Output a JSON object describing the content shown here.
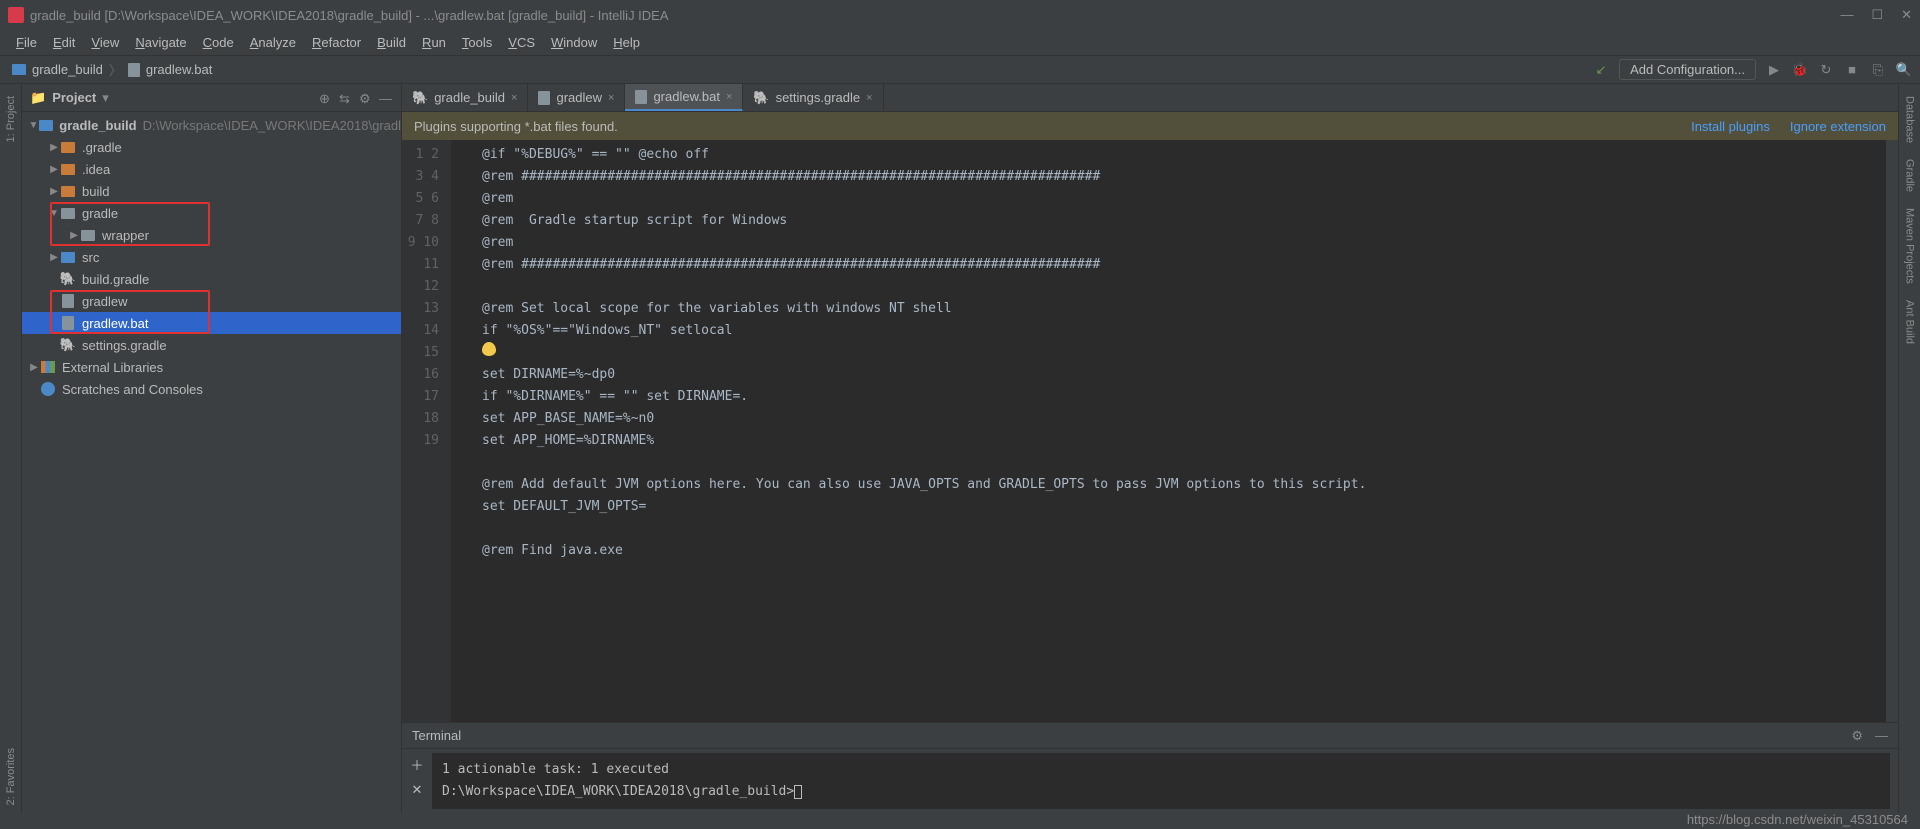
{
  "title": "gradle_build [D:\\Workspace\\IDEA_WORK\\IDEA2018\\gradle_build] - ...\\gradlew.bat [gradle_build] - IntelliJ IDEA",
  "menus": [
    "File",
    "Edit",
    "View",
    "Navigate",
    "Code",
    "Analyze",
    "Refactor",
    "Build",
    "Run",
    "Tools",
    "VCS",
    "Window",
    "Help"
  ],
  "breadcrumbs": [
    {
      "icon": "folder",
      "label": "gradle_build"
    },
    {
      "icon": "file",
      "label": "gradlew.bat"
    }
  ],
  "run_config_placeholder": "Add Configuration...",
  "project_panel": {
    "title": "Project"
  },
  "tree": {
    "root_label": "gradle_build",
    "root_path": "D:\\Workspace\\IDEA_WORK\\IDEA2018\\gradl",
    "items": [
      {
        "indent": 1,
        "arrow": "▶",
        "icon": "folder-orange",
        "label": ".gradle"
      },
      {
        "indent": 1,
        "arrow": "▶",
        "icon": "folder-orange",
        "label": ".idea"
      },
      {
        "indent": 1,
        "arrow": "▶",
        "icon": "folder-orange",
        "label": "build"
      },
      {
        "indent": 1,
        "arrow": "▼",
        "icon": "folder",
        "label": "gradle",
        "hl": "top"
      },
      {
        "indent": 2,
        "arrow": "▶",
        "icon": "folder",
        "label": "wrapper",
        "hl": "bottom"
      },
      {
        "indent": 1,
        "arrow": "▶",
        "icon": "folder-blue",
        "label": "src"
      },
      {
        "indent": 1,
        "arrow": "",
        "icon": "gradle",
        "label": "build.gradle"
      },
      {
        "indent": 1,
        "arrow": "",
        "icon": "file",
        "label": "gradlew",
        "hl": "top2"
      },
      {
        "indent": 1,
        "arrow": "",
        "icon": "file",
        "label": "gradlew.bat",
        "selected": true,
        "hl": "bottom2"
      },
      {
        "indent": 1,
        "arrow": "",
        "icon": "gradle",
        "label": "settings.gradle"
      }
    ],
    "external_libs": "External Libraries",
    "scratches": "Scratches and Consoles"
  },
  "tabs": [
    {
      "icon": "gradle",
      "label": "gradle_build",
      "active": false
    },
    {
      "icon": "file",
      "label": "gradlew",
      "active": false
    },
    {
      "icon": "file",
      "label": "gradlew.bat",
      "active": true
    },
    {
      "icon": "gradle",
      "label": "settings.gradle",
      "active": false
    }
  ],
  "banner": {
    "message": "Plugins supporting *.bat files found.",
    "link1": "Install plugins",
    "link2": "Ignore extension"
  },
  "code_lines": [
    "@if \"%DEBUG%\" == \"\" @echo off",
    "@rem ##########################################################################",
    "@rem",
    "@rem  Gradle startup script for Windows",
    "@rem",
    "@rem ##########################################################################",
    "",
    "@rem Set local scope for the variables with windows NT shell",
    "if \"%OS%\"==\"Windows_NT\" setlocal",
    "__BULB__",
    "set DIRNAME=%~dp0",
    "if \"%DIRNAME%\" == \"\" set DIRNAME=.",
    "set APP_BASE_NAME=%~n0",
    "set APP_HOME=%DIRNAME%",
    "",
    "@rem Add default JVM options here. You can also use JAVA_OPTS and GRADLE_OPTS to pass JVM options to this script.",
    "set DEFAULT_JVM_OPTS=",
    "",
    "@rem Find java.exe"
  ],
  "terminal": {
    "title": "Terminal",
    "lines": [
      "1 actionable task: 1 executed",
      "D:\\Workspace\\IDEA_WORK\\IDEA2018\\gradle_build>"
    ]
  },
  "side_tabs": {
    "left_top": "1: Project",
    "left_bottom": "2: Favorites",
    "right": [
      "Database",
      "Gradle",
      "Maven Projects",
      "Ant Build"
    ]
  },
  "watermark": "https://blog.csdn.net/weixin_45310564"
}
